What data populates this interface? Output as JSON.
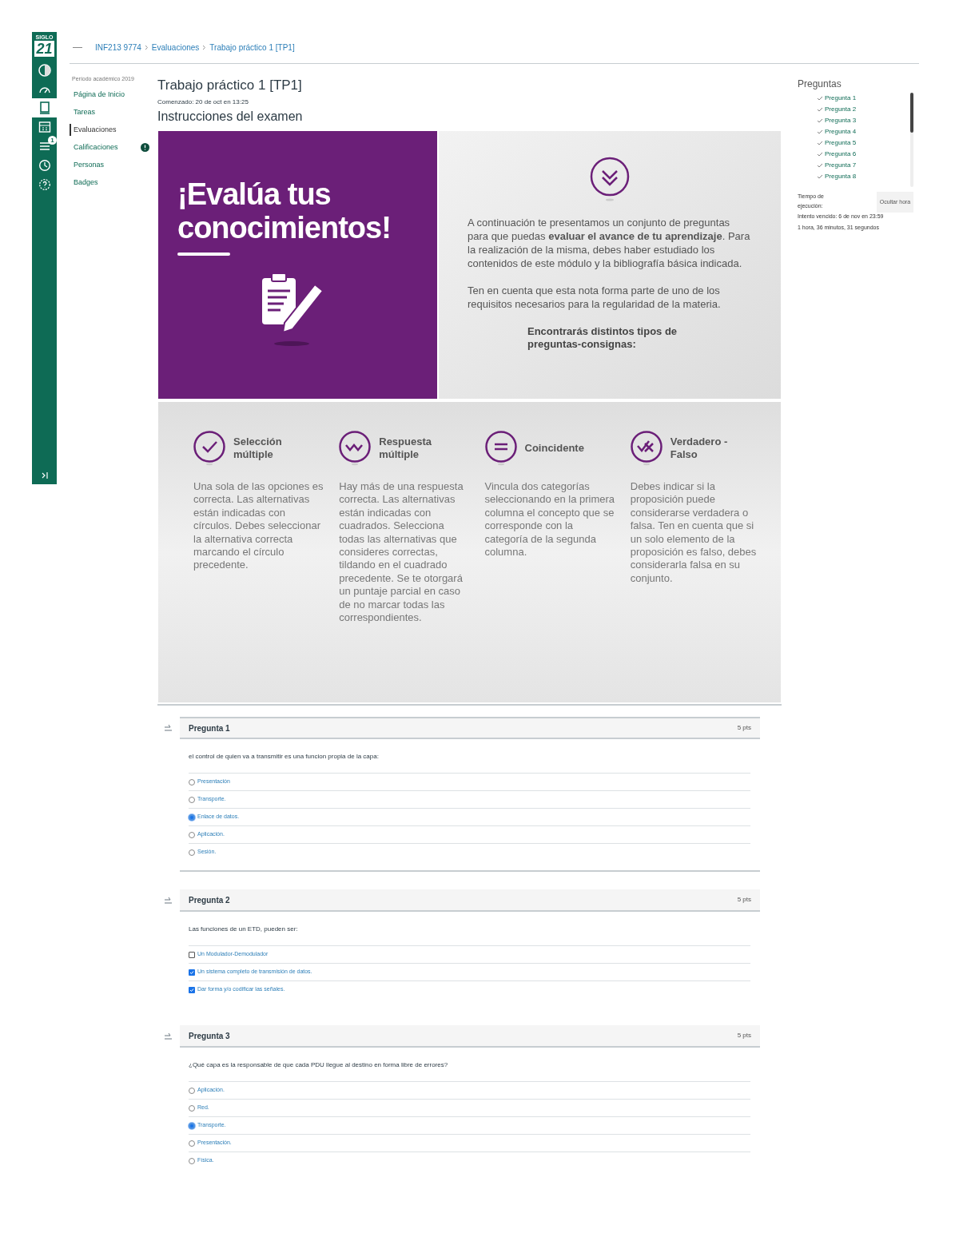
{
  "breadcrumb": [
    "INF213 9774",
    "Evaluaciones",
    "Trabajo práctico 1 [TP1]"
  ],
  "rail": {
    "logo_top": "SIGLO",
    "logo_number": "21",
    "inbox_badge": "1"
  },
  "course_nav": {
    "term": "Período académico 2019",
    "items": [
      {
        "label": "Página de Inicio",
        "selected": false
      },
      {
        "label": "Tareas",
        "selected": false
      },
      {
        "label": "Evaluaciones",
        "selected": true
      },
      {
        "label": "Calificaciones",
        "selected": false,
        "alert": true
      },
      {
        "label": "Personas",
        "selected": false
      },
      {
        "label": "Badges",
        "selected": false
      }
    ]
  },
  "page": {
    "title": "Trabajo práctico 1 [TP1]",
    "started": "Comenzado: 20 de oct en 13:25",
    "section": "Instrucciones del examen"
  },
  "banner": {
    "headline": "¡Evalúa tus conocimientos!",
    "intro": "A continuación te presentamos un conjunto de preguntas para que puedas **evaluar el avance de tu aprendizaje**. Para la realización de la misma, debes haber estudiado los contenidos de este módulo y la bibliografía básica indicada.",
    "note": "Ten en cuenta que esta nota forma parte de uno de los requisitos necesarios para la regularidad de la materia.",
    "types_heading": "Encontrarás distintos tipos de preguntas-consignas:"
  },
  "question_types": [
    {
      "kind": "check",
      "title": "Selección múltiple",
      "text": "Una sola de las opciones es correcta. Las alternativas están indicadas con círculos. Debes seleccionar la alternativa correcta marcando el círculo precedente."
    },
    {
      "kind": "wave",
      "title": "Respuesta múltiple",
      "text": "Hay más de una respuesta correcta. Las alternativas están indicadas con cuadrados. Selecciona todas las alternativas que consideres correctas, tildando en el cuadrado precedente. Se te otorgará un puntaje parcial en caso de no marcar todas las correspondientes."
    },
    {
      "kind": "equals",
      "title": "Coincidente",
      "text": "Vincula dos categorías seleccionando en la primera columna el concepto que se corresponde con la categoría de la segunda columna."
    },
    {
      "kind": "truefalse",
      "title": "Verdadero - Falso",
      "text": "Debes indicar si la proposición puede considerarse verdadera o falsa. Ten en cuenta que si un solo elemento de la proposición es falso, debes considerarla falsa en su conjunto."
    }
  ],
  "questions": [
    {
      "title": "Pregunta 1",
      "points": "5 pts",
      "prompt": "el control de quien va a transmitir es una funcion propia de la capa:",
      "kind": "radio",
      "options": [
        {
          "label": "Presentación",
          "selected": false
        },
        {
          "label": "Transporte.",
          "selected": false
        },
        {
          "label": "Enlace de datos.",
          "selected": true
        },
        {
          "label": "Aplicación.",
          "selected": false
        },
        {
          "label": "Sesión.",
          "selected": false
        }
      ]
    },
    {
      "title": "Pregunta 2",
      "points": "5 pts",
      "prompt": "Las funciones de un ETD, pueden ser:",
      "kind": "checkbox",
      "options": [
        {
          "label": "Un Modulador-Demodulador",
          "selected": false
        },
        {
          "label": "Un sistema completo de transmisión de datos.",
          "selected": true
        },
        {
          "label": "Dar forma y/o codificar las señales.",
          "selected": true
        }
      ]
    },
    {
      "title": "Pregunta 3",
      "points": "5 pts",
      "prompt": "¿Qué capa es la responsable de que cada PDU llegue al destino en forma libre de errores?",
      "kind": "radio",
      "options": [
        {
          "label": "Aplicación.",
          "selected": false
        },
        {
          "label": "Red.",
          "selected": false
        },
        {
          "label": "Transporte.",
          "selected": true
        },
        {
          "label": "Presentación.",
          "selected": false
        },
        {
          "label": "Física.",
          "selected": false
        }
      ]
    }
  ],
  "sidebar": {
    "heading": "Preguntas",
    "items": [
      {
        "label": "Pregunta 1",
        "answered": true
      },
      {
        "label": "Pregunta 2",
        "answered": true
      },
      {
        "label": "Pregunta 3",
        "answered": true
      },
      {
        "label": "Pregunta 4",
        "answered": true
      },
      {
        "label": "Pregunta 5",
        "answered": true
      },
      {
        "label": "Pregunta 6",
        "answered": true
      },
      {
        "label": "Pregunta 7",
        "answered": true
      },
      {
        "label": "Pregunta 8",
        "answered": true
      }
    ],
    "timer_label": "Tiempo de ejecución:",
    "hide_button": "Ocultar hora",
    "due": "Intento vencido: 6 de nov en 23:59",
    "elapsed": "1 hora, 36 minutos, 31 segundos"
  }
}
